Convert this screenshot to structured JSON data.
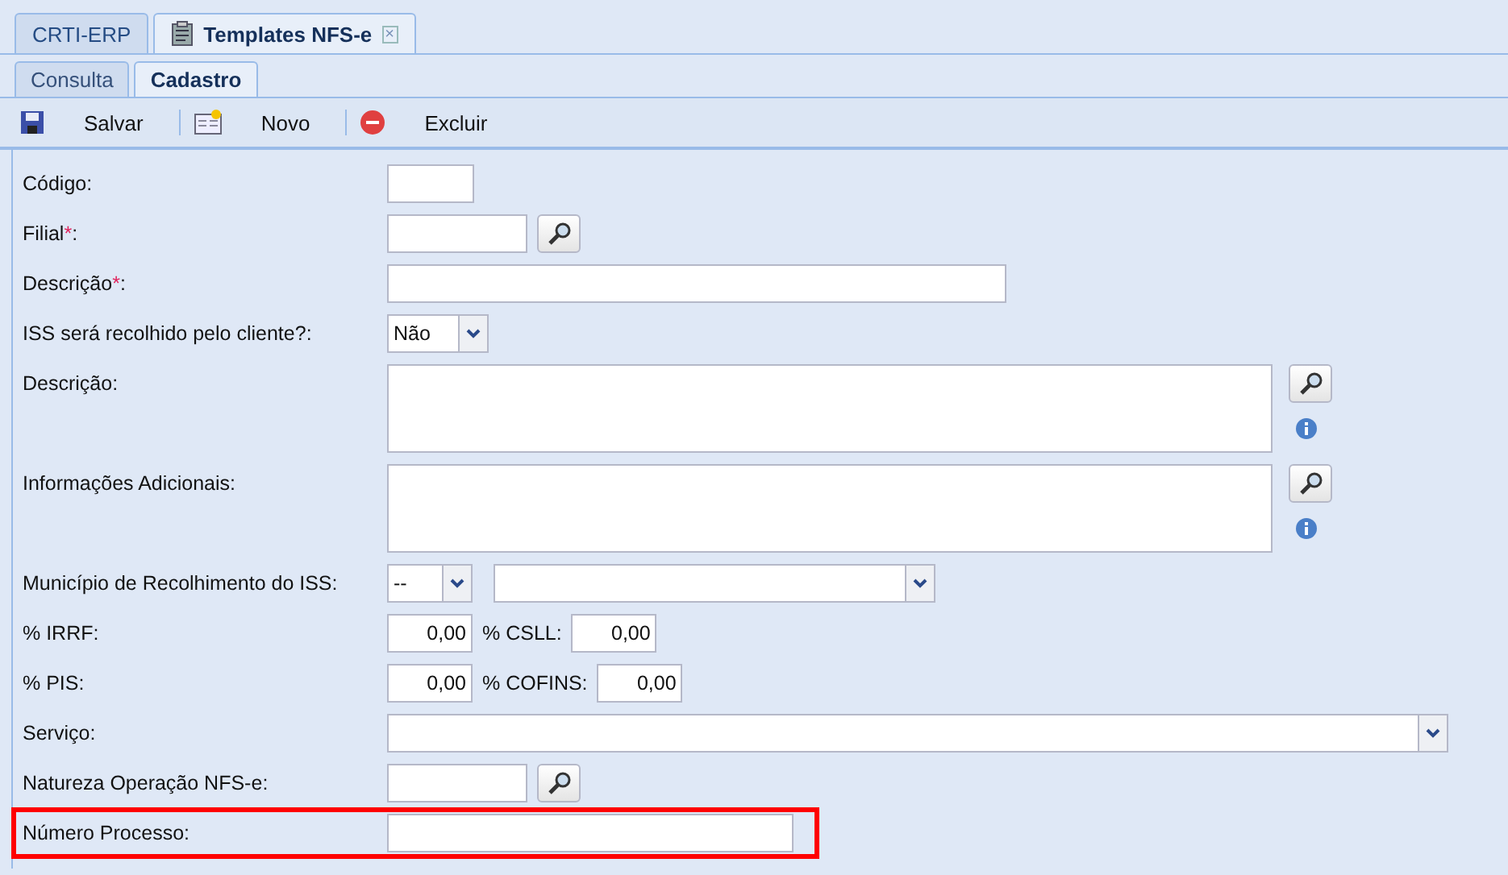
{
  "main_tabs": [
    {
      "label": "CRTI-ERP",
      "selected": false,
      "kind": "module"
    },
    {
      "label": "Templates NFS-e",
      "selected": true,
      "kind": "document",
      "close": "×"
    }
  ],
  "sub_tabs": [
    {
      "label": "Consulta",
      "selected": false
    },
    {
      "label": "Cadastro",
      "selected": true
    }
  ],
  "toolbar": [
    {
      "label": "Salvar",
      "kind": "save"
    },
    {
      "label": "Novo",
      "kind": "new"
    },
    {
      "label": "Excluir",
      "kind": "delete"
    }
  ],
  "fields": [
    {
      "label": "Código",
      "suffix": ":",
      "kind": "short",
      "highlighted": false
    },
    {
      "label": "Filial",
      "required_mark": "*",
      "suffix": ":",
      "kind": "lookup",
      "highlighted": false
    },
    {
      "label": "Descrição",
      "required_mark": "*",
      "suffix": ":",
      "kind": "text",
      "highlighted": false
    },
    {
      "label": "ISS será recolhido pelo cliente?",
      "suffix": ":",
      "kind": "select",
      "value": "Não",
      "highlighted": false
    },
    {
      "label": "Descrição",
      "suffix": ":",
      "kind": "memo",
      "highlighted": false
    },
    {
      "label": "Informações Adicionais",
      "suffix": ":",
      "kind": "memo",
      "highlighted": false
    },
    {
      "label": "Município de Recolhimento do ISS",
      "suffix": ":",
      "kind": "double_select",
      "value": "--",
      "highlighted": false
    },
    {
      "label": "% IRRF",
      "suffix": ":",
      "kind": "pair",
      "value": "0,00",
      "label2": "% CSLL:",
      "value2": "0,00",
      "highlighted": false
    },
    {
      "label": "% PIS",
      "suffix": ":",
      "kind": "pair",
      "value": "0,00",
      "label2": "% COFINS:",
      "value2": "0,00",
      "highlighted": false
    },
    {
      "label": "Serviço",
      "suffix": ":",
      "kind": "combo",
      "highlighted": false
    },
    {
      "label": "Natureza Operação NFS-e",
      "suffix": ":",
      "kind": "lookup",
      "highlighted": false
    },
    {
      "label": "Número Processo",
      "suffix": ":",
      "kind": "text",
      "highlighted": true
    }
  ]
}
